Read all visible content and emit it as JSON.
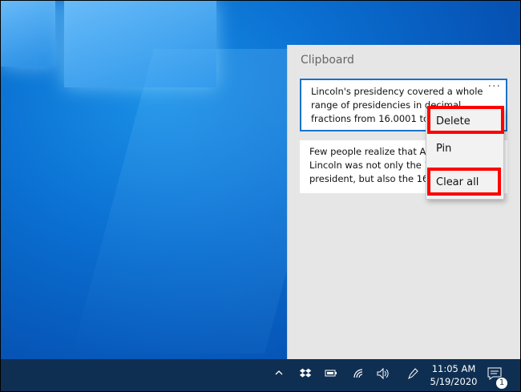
{
  "clipboard": {
    "title": "Clipboard",
    "items": [
      {
        "text": "Lincoln's presidency covered a whole\nrange of presidencies in decimal\nfractions from 16.0001 to 16",
        "more_label": "···"
      },
      {
        "text": "Few people realize that Abr\nLincoln was not only the 16\npresident, but also the 16.5"
      }
    ]
  },
  "context_menu": {
    "items": [
      "Delete",
      "Pin",
      "Clear all"
    ]
  },
  "taskbar": {
    "time": "11:05 AM",
    "date": "5/19/2020",
    "notification_count": "1",
    "icons": [
      "chevron-up-icon",
      "dropbox-icon",
      "battery-icon",
      "wifi-icon",
      "volume-icon",
      "pen-icon",
      "action-center-icon"
    ]
  },
  "colors": {
    "highlight": "#ff0000",
    "selection_border": "#1a73c7",
    "taskbar": "#0f2f52"
  }
}
